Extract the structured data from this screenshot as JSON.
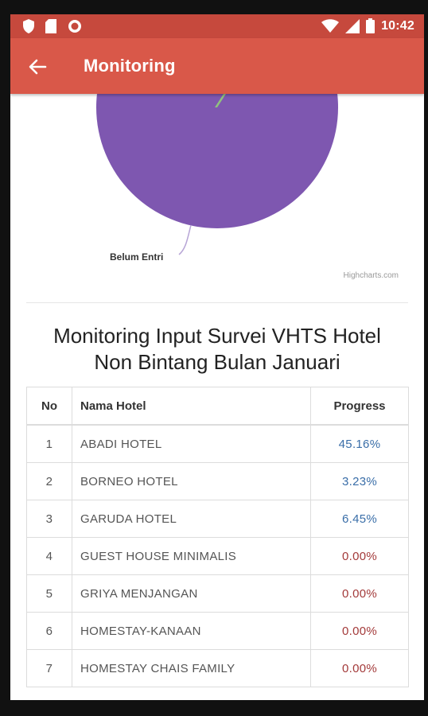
{
  "status_bar": {
    "time": "10:42",
    "icons": [
      "shield-icon",
      "sim-card-icon",
      "record-icon",
      "wifi-icon",
      "signal-icon",
      "battery-icon"
    ]
  },
  "app_bar": {
    "title": "Monitoring",
    "back_icon": "arrow-left-icon"
  },
  "chart": {
    "label": "Belum Entri",
    "credit": "Highcharts.com",
    "colors": {
      "main_slice": "#7e57b0",
      "small_slice": "#90c27d"
    }
  },
  "section": {
    "heading_line1": "Monitoring Input Survei VHTS Hotel",
    "heading_line2": "Non Bintang Bulan Januari"
  },
  "table": {
    "headers": {
      "no": "No",
      "name": "Nama Hotel",
      "progress": "Progress"
    },
    "rows": [
      {
        "no": "1",
        "name": "ABADI HOTEL",
        "progress": "45.16%",
        "status": "pos"
      },
      {
        "no": "2",
        "name": "BORNEO HOTEL",
        "progress": "3.23%",
        "status": "pos"
      },
      {
        "no": "3",
        "name": "GARUDA HOTEL",
        "progress": "6.45%",
        "status": "pos"
      },
      {
        "no": "4",
        "name": "GUEST HOUSE MINIMALIS",
        "progress": "0.00%",
        "status": "zero"
      },
      {
        "no": "5",
        "name": "GRIYA MENJANGAN",
        "progress": "0.00%",
        "status": "zero"
      },
      {
        "no": "6",
        "name": "HOMESTAY-KANAAN",
        "progress": "0.00%",
        "status": "zero"
      },
      {
        "no": "7",
        "name": "HOMESTAY CHAIS FAMILY",
        "progress": "0.00%",
        "status": "zero"
      }
    ],
    "colors": {
      "positive": "#3a6ea8",
      "zero": "#a33a3a"
    }
  }
}
